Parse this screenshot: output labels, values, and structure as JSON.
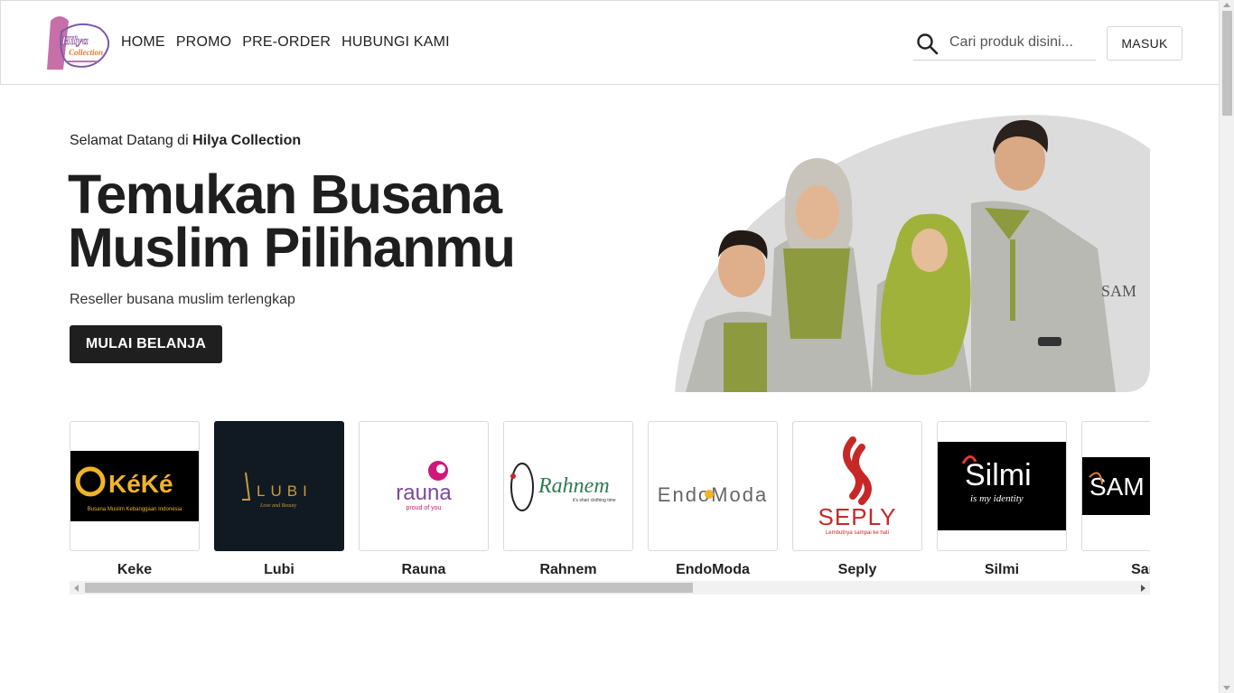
{
  "header": {
    "nav": [
      "HOME",
      "PROMO",
      "PRE-ORDER",
      "HUBUNGI KAMI"
    ],
    "search_placeholder": "Cari produk disini...",
    "login_label": "MASUK",
    "logo_text": [
      "Hilya",
      "Collection"
    ]
  },
  "hero": {
    "welcome_prefix": "Selamat Datang di",
    "welcome_brand": "Hilya Collection",
    "title_line1": "Temukan Busana",
    "title_line2": "Muslim Pilihanmu",
    "subtitle": "Reseller busana muslim terlengkap",
    "cta_label": "MULAI BELANJA"
  },
  "brands": [
    {
      "name": "Keke",
      "logo_text": "KéKé",
      "tagline": "Busana Muslim Kebanggaan Indonesia"
    },
    {
      "name": "Lubi",
      "logo_text": "LUBI",
      "tagline": "Love and Beauty"
    },
    {
      "name": "Rauna",
      "logo_text": "rauna",
      "tagline": "proud of you"
    },
    {
      "name": "Rahnem",
      "logo_text": "Rahnem",
      "tagline": "it's shari clothing time"
    },
    {
      "name": "EndoModa",
      "logo_text": "EndoModa",
      "tagline": ""
    },
    {
      "name": "Seply",
      "logo_text": "SEPLY",
      "tagline": "Lembutnya sampai ke hati"
    },
    {
      "name": "Silmi",
      "logo_text": "Silmi",
      "tagline": "is my identity"
    },
    {
      "name": "Sam",
      "logo_text": "SAM",
      "tagline": ""
    }
  ],
  "colors": {
    "primary_dark": "#1f1f1f",
    "keke_gold": "#f0b429",
    "rauna_magenta": "#c2185b",
    "seply_red": "#c62828",
    "rahnem_green": "#2e7d4f"
  }
}
